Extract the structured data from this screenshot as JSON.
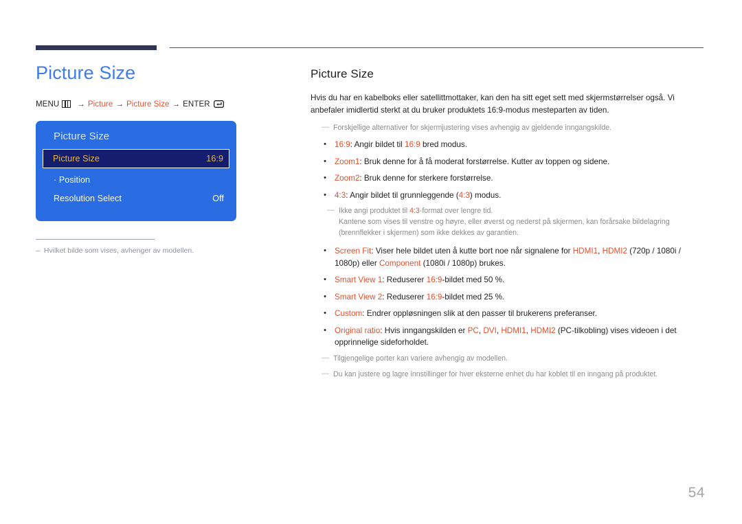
{
  "page": {
    "number": "54"
  },
  "left": {
    "title": "Picture Size",
    "menu_path": {
      "menu_label": "MENU",
      "menu_icon": "menu-grid-icon",
      "arrow": "→",
      "item1": "Picture",
      "item2": "Picture Size",
      "enter_label": "ENTER",
      "enter_icon": "enter-return-icon"
    },
    "osd": {
      "title": "Picture Size",
      "rows": [
        {
          "label": "Picture Size",
          "value": "16:9",
          "selected": true
        },
        {
          "label": "· Position",
          "value": "",
          "selected": false
        },
        {
          "label": "Resolution Select",
          "value": "Off",
          "selected": false
        }
      ]
    },
    "footnote": {
      "dash": "–",
      "text": "Hvilket bilde som vises, avhenger av modellen."
    }
  },
  "right": {
    "title": "Picture Size",
    "intro": "Hvis du har en kabelboks eller satellittmottaker, kan den ha sitt eget sett med skjermstørrelser også. Vi anbefaler imidlertid sterkt at du bruker produktets 16:9-modus mesteparten av tiden.",
    "note_top": "Forskjellige alternativer for skjermjustering vises avhengig av gjeldende inngangskilde.",
    "bullets": [
      {
        "term": "16:9",
        "rest_pre": ": Angir bildet til ",
        "highlight": "16:9",
        "rest_post": " bred modus."
      },
      {
        "term": "Zoom1",
        "rest_pre": ": Bruk denne for å få moderat forstørrelse. Kutter av toppen og sidene.",
        "highlight": "",
        "rest_post": ""
      },
      {
        "term": "Zoom2",
        "rest_pre": ": Bruk denne for sterkere forstørrelse.",
        "highlight": "",
        "rest_post": ""
      },
      {
        "term": "4:3",
        "rest_pre": ": Angir bildet til grunnleggende (",
        "highlight": "4:3",
        "rest_post": ") modus."
      }
    ],
    "note_43_line1_pre": "Ikke angi produktet til ",
    "note_43_line1_hl": "4:3",
    "note_43_line1_post": "-format over lengre tid.",
    "note_43_line2": "Kantene som vises til venstre og høyre, eller øverst og nederst på skjermen, kan forårsake bildelagring (brennflekker i skjermen) som ikke dekkes av garantien.",
    "bullet_screenfit": {
      "term": "Screen Fit",
      "p1": ": Viser hele bildet uten å kutte bort noe når signalene for ",
      "hdmi1": "HDMI1",
      "p2": ", ",
      "hdmi2": "HDMI2",
      "p3": " (720p / 1080i / 1080p) eller ",
      "component": "Component",
      "p4": " (1080i / 1080p) brukes."
    },
    "bullet_sv1": {
      "term": "Smart View 1",
      "p1": ": Reduserer ",
      "hl": "16:9",
      "p2": "-bildet med 50 %."
    },
    "bullet_sv2": {
      "term": "Smart View 2",
      "p1": ": Reduserer ",
      "hl": "16:9",
      "p2": "-bildet med 25 %."
    },
    "bullet_custom": {
      "term": "Custom",
      "p1": ": Endrer oppløsningen slik at den passer til brukerens preferanser."
    },
    "bullet_original": {
      "term": "Original ratio",
      "p1": ": Hvis inngangskilden er ",
      "pc": "PC",
      "p2": ", ",
      "dvi": "DVI",
      "p3": ", ",
      "hdmi1": "HDMI1",
      "p4": ", ",
      "hdmi2": "HDMI2",
      "p5": " (PC-tilkobling) vises videoen i det opprinnelige sideforholdet."
    },
    "note_ports": "Tilgjengelige porter kan variere avhengig av modellen.",
    "note_store": "Du kan justere og lagre innstillinger for hver eksterne enhet du har koblet til en inngang på produktet.",
    "dash": "—"
  },
  "colors": {
    "accent_blue": "#3f7de9",
    "osd_blue": "#2a6de3",
    "osd_selected": "#141d6e",
    "osd_gold": "#e5b84b",
    "orange": "#e8502e",
    "rule_navy": "#2e3557"
  }
}
